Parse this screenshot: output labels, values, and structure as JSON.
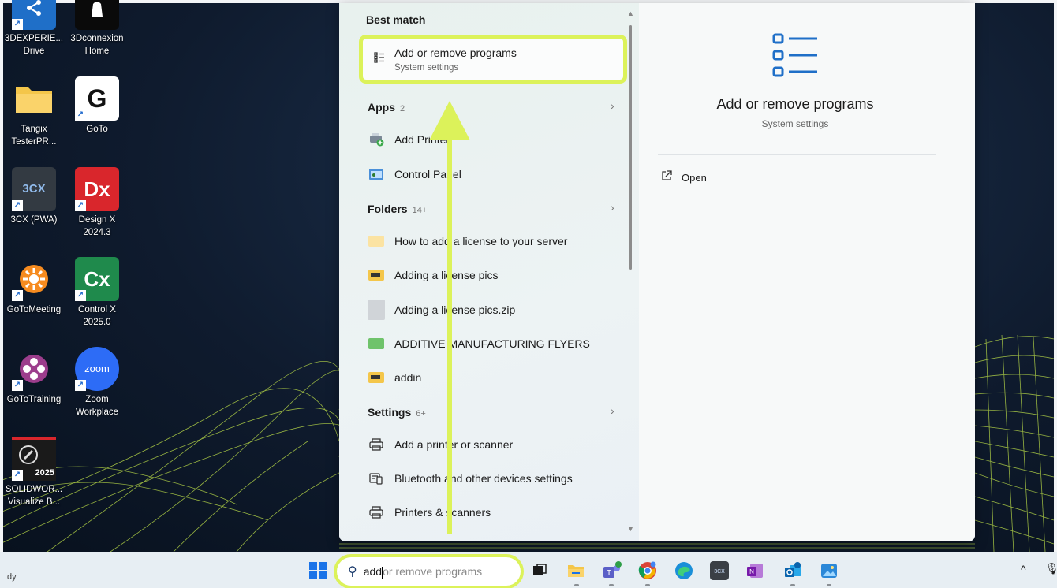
{
  "desktop_icons": [
    {
      "label": "3DEXPERIE... Drive",
      "line1": "3DEXPERIE...",
      "line2": "Drive"
    },
    {
      "label": "3Dconnexion Home",
      "line1": "3Dconnexion",
      "line2": "Home"
    },
    {
      "label": "Tangix TesterPR...",
      "line1": "Tangix",
      "line2": "TesterPR..."
    },
    {
      "label": "GoTo",
      "line1": "GoTo",
      "line2": ""
    },
    {
      "label": "3CX (PWA)",
      "line1": "3CX (PWA)",
      "line2": "",
      "glyph": "3CX"
    },
    {
      "label": "Design X 2024.3",
      "line1": "Design X",
      "line2": "2024.3",
      "glyph": "Dx"
    },
    {
      "label": "GoToMeeting",
      "line1": "GoToMeeting",
      "line2": ""
    },
    {
      "label": "Control X 2025.0",
      "line1": "Control X",
      "line2": "2025.0",
      "glyph": "Cx"
    },
    {
      "label": "GoToTraining",
      "line1": "GoToTraining",
      "line2": ""
    },
    {
      "label": "Zoom Workplace",
      "line1": "Zoom",
      "line2": "Workplace",
      "glyph": "zoom"
    },
    {
      "label": "SOLIDWOR... Visualize B...",
      "line1": "SOLIDWOR...",
      "line2": "Visualize B...",
      "glyph": "2025"
    }
  ],
  "goto_glyph": "G",
  "search": {
    "best_match_heading": "Best match",
    "best_match": {
      "title": "Add or remove programs",
      "subtitle": "System settings"
    },
    "apps": {
      "heading": "Apps",
      "count": "2",
      "items": [
        "Add Printer",
        "Control Panel"
      ]
    },
    "folders": {
      "heading": "Folders",
      "count": "14+",
      "items": [
        "How to add a license to your server",
        "Adding a license pics",
        "Adding a license pics.zip",
        "ADDITIVE MANUFACTURING FLYERS",
        "addin"
      ]
    },
    "settings": {
      "heading": "Settings",
      "count": "6+",
      "items": [
        "Add a printer or scanner",
        "Bluetooth and other devices settings",
        "Printers & scanners"
      ]
    }
  },
  "detail": {
    "title": "Add or remove programs",
    "subtitle": "System settings",
    "open_label": "Open"
  },
  "taskbar": {
    "weather_text": "ıdy",
    "search_typed": "add",
    "search_completion": " or remove programs"
  },
  "colors": {
    "highlight": "#dcf25a",
    "accent_blue": "#1a66cc",
    "mesh": "#c5e84a"
  }
}
